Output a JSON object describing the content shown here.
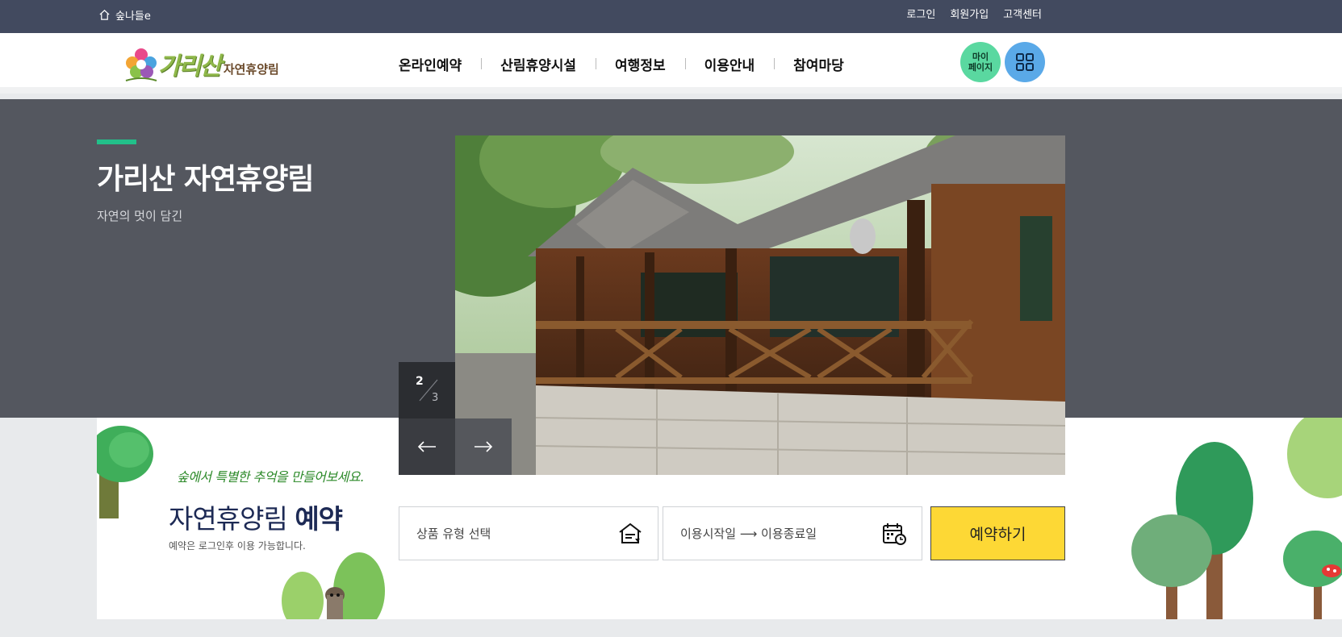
{
  "topbar": {
    "home_label": "숲나들e",
    "links": {
      "login": "로그인",
      "signup": "회원가입",
      "support": "고객센터"
    }
  },
  "header": {
    "logo": {
      "big": "가리산",
      "small": "자연휴양림"
    },
    "nav": [
      "온라인예약",
      "산림휴양시설",
      "여행정보",
      "이용안내",
      "참여마당"
    ],
    "mypage_label": "마이\n페이지",
    "menu_icon": "grid-icon"
  },
  "hero": {
    "title": "가리산 자연휴양림",
    "subtitle": "자연의 멋이 담긴",
    "slide": {
      "current": "2",
      "total": "3"
    },
    "prev_icon": "arrow-left-icon",
    "next_icon": "arrow-right-icon"
  },
  "booking": {
    "tagline": "숲에서 특별한 추억을 만들어보세요.",
    "title_normal": "자연휴양림",
    "title_bold": "예약",
    "note": "예약은 로그인후 이용 가능합니다.",
    "type_placeholder": "상품 유형 선택",
    "date_placeholder": "이용시작일 ⟶ 이용종료일",
    "reserve_label": "예약하기"
  },
  "colors": {
    "topbar": "#424a5f",
    "hero": "#54575f",
    "accent": "#22c08a",
    "mypage": "#5ad8a0",
    "menu": "#5aa9e8",
    "reserve": "#fdd835"
  }
}
